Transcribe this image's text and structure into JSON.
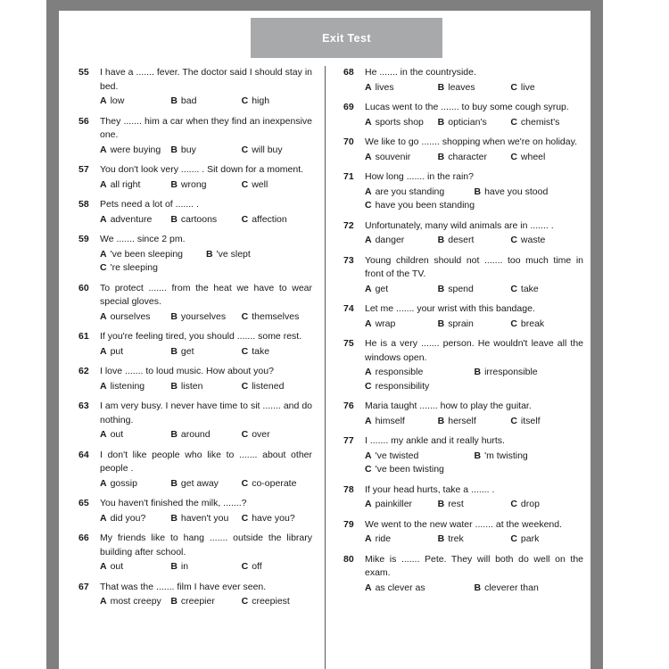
{
  "header": {
    "exit_label": "Exit Test"
  },
  "colors": {
    "frame_gray": "#7f7f7f",
    "exit_bar_gray": "#a7a9ab",
    "text": "#1a1a1a",
    "page_white": "#ffffff",
    "divider": "#58585a"
  },
  "left_column": [
    {
      "number": "55",
      "stem": "I have a ....... fever. The doctor said I should stay in bed.",
      "layout": "cols3",
      "options": [
        {
          "letter": "A",
          "text": "low"
        },
        {
          "letter": "B",
          "text": "bad"
        },
        {
          "letter": "C",
          "text": "high"
        }
      ]
    },
    {
      "number": "56",
      "stem": "They ....... him a car when they find an inexpensive one.",
      "layout": "cols3",
      "options": [
        {
          "letter": "A",
          "text": "were buying"
        },
        {
          "letter": "B",
          "text": "buy"
        },
        {
          "letter": "C",
          "text": "will buy"
        }
      ]
    },
    {
      "number": "57",
      "stem": "You don't look very ....... . Sit down for a moment.",
      "layout": "cols3",
      "options": [
        {
          "letter": "A",
          "text": "all right"
        },
        {
          "letter": "B",
          "text": "wrong"
        },
        {
          "letter": "C",
          "text": "well"
        }
      ]
    },
    {
      "number": "58",
      "stem": "Pets need a lot of ....... .",
      "layout": "cols3",
      "options": [
        {
          "letter": "A",
          "text": "adventure"
        },
        {
          "letter": "B",
          "text": "cartoons"
        },
        {
          "letter": "C",
          "text": "affection"
        }
      ]
    },
    {
      "number": "59",
      "stem": "We ....... since 2 pm.",
      "layout": "cols2",
      "options": [
        {
          "letter": "A",
          "text": "'ve been sleeping"
        },
        {
          "letter": "B",
          "text": "'ve slept"
        },
        {
          "letter": "C",
          "text": "'re sleeping",
          "full": true
        }
      ]
    },
    {
      "number": "60",
      "stem": "To protect ....... from the heat we have to wear special gloves.",
      "layout": "cols3",
      "options": [
        {
          "letter": "A",
          "text": "ourselves"
        },
        {
          "letter": "B",
          "text": "yourselves"
        },
        {
          "letter": "C",
          "text": "themselves"
        }
      ]
    },
    {
      "number": "61",
      "stem": "If you're feeling tired, you should ....... some rest.",
      "layout": "cols3",
      "options": [
        {
          "letter": "A",
          "text": "put"
        },
        {
          "letter": "B",
          "text": "get"
        },
        {
          "letter": "C",
          "text": "take"
        }
      ]
    },
    {
      "number": "62",
      "stem": "I love ....... to loud music. How about you?",
      "layout": "cols3",
      "options": [
        {
          "letter": "A",
          "text": "listening"
        },
        {
          "letter": "B",
          "text": "listen"
        },
        {
          "letter": "C",
          "text": "listened"
        }
      ]
    },
    {
      "number": "63",
      "stem": "I am very busy. I never have time to sit ....... and do nothing.",
      "layout": "cols3",
      "options": [
        {
          "letter": "A",
          "text": "out"
        },
        {
          "letter": "B",
          "text": "around"
        },
        {
          "letter": "C",
          "text": "over"
        }
      ]
    },
    {
      "number": "64",
      "stem": "I don't like people who like to ....... about other people .",
      "layout": "cols3",
      "options": [
        {
          "letter": "A",
          "text": "gossip"
        },
        {
          "letter": "B",
          "text": "get away"
        },
        {
          "letter": "C",
          "text": "co-operate"
        }
      ]
    },
    {
      "number": "65",
      "stem": "You haven't finished the milk, .......?",
      "layout": "cols3",
      "options": [
        {
          "letter": "A",
          "text": "did you?"
        },
        {
          "letter": "B",
          "text": "haven't you"
        },
        {
          "letter": "C",
          "text": "have you?"
        }
      ]
    },
    {
      "number": "66",
      "stem": "My friends like to hang ....... outside the library building after school.",
      "layout": "cols3",
      "options": [
        {
          "letter": "A",
          "text": "out"
        },
        {
          "letter": "B",
          "text": "in"
        },
        {
          "letter": "C",
          "text": "off"
        }
      ]
    },
    {
      "number": "67",
      "stem": "That was the ....... film I have ever seen.",
      "layout": "cols3",
      "options": [
        {
          "letter": "A",
          "text": "most creepy"
        },
        {
          "letter": "B",
          "text": "creepier"
        },
        {
          "letter": "C",
          "text": "creepiest"
        }
      ]
    }
  ],
  "right_column": [
    {
      "number": "68",
      "stem": "He ....... in the countryside.",
      "layout": "cols3",
      "options": [
        {
          "letter": "A",
          "text": "lives"
        },
        {
          "letter": "B",
          "text": "leaves"
        },
        {
          "letter": "C",
          "text": "live"
        }
      ]
    },
    {
      "number": "69",
      "stem": "Lucas went to the ....... to buy some cough syrup.",
      "layout": "cols3",
      "options": [
        {
          "letter": "A",
          "text": "sports shop"
        },
        {
          "letter": "B",
          "text": "optician's"
        },
        {
          "letter": "C",
          "text": "chemist's"
        }
      ]
    },
    {
      "number": "70",
      "stem": "We like to go ....... shopping when we're on holiday.",
      "layout": "cols3",
      "options": [
        {
          "letter": "A",
          "text": "souvenir"
        },
        {
          "letter": "B",
          "text": "character"
        },
        {
          "letter": "C",
          "text": "wheel"
        }
      ]
    },
    {
      "number": "71",
      "stem": "How long ....... in the rain?",
      "layout": "cols2",
      "options": [
        {
          "letter": "A",
          "text": "are you standing"
        },
        {
          "letter": "B",
          "text": "have you stood"
        },
        {
          "letter": "C",
          "text": "have you been standing",
          "full": true
        }
      ]
    },
    {
      "number": "72",
      "stem": "Unfortunately, many wild animals are in ....... .",
      "layout": "cols3",
      "options": [
        {
          "letter": "A",
          "text": "danger"
        },
        {
          "letter": "B",
          "text": "desert"
        },
        {
          "letter": "C",
          "text": "waste"
        }
      ]
    },
    {
      "number": "73",
      "stem": "Young children should not ....... too much time in front of the TV.",
      "layout": "cols3",
      "options": [
        {
          "letter": "A",
          "text": "get"
        },
        {
          "letter": "B",
          "text": "spend"
        },
        {
          "letter": "C",
          "text": "take"
        }
      ]
    },
    {
      "number": "74",
      "stem": "Let me ....... your wrist with this bandage.",
      "layout": "cols3",
      "options": [
        {
          "letter": "A",
          "text": "wrap"
        },
        {
          "letter": "B",
          "text": "sprain"
        },
        {
          "letter": "C",
          "text": "break"
        }
      ]
    },
    {
      "number": "75",
      "stem": "He is a very ....... person. He wouldn't leave all the windows open.",
      "layout": "cols2",
      "options": [
        {
          "letter": "A",
          "text": "responsible"
        },
        {
          "letter": "B",
          "text": "irresponsible"
        },
        {
          "letter": "C",
          "text": "responsibility",
          "full": true
        }
      ]
    },
    {
      "number": "76",
      "stem": "Maria taught ....... how to play the guitar.",
      "layout": "cols3",
      "options": [
        {
          "letter": "A",
          "text": "himself"
        },
        {
          "letter": "B",
          "text": "herself"
        },
        {
          "letter": "C",
          "text": "itself"
        }
      ]
    },
    {
      "number": "77",
      "stem": "I ....... my ankle and it really hurts.",
      "layout": "cols2",
      "options": [
        {
          "letter": "A",
          "text": "'ve twisted"
        },
        {
          "letter": "B",
          "text": "'m twisting"
        },
        {
          "letter": "C",
          "text": "'ve been twisting",
          "full": true
        }
      ]
    },
    {
      "number": "78",
      "stem": "If your head hurts, take a ....... .",
      "layout": "cols3",
      "options": [
        {
          "letter": "A",
          "text": "painkiller"
        },
        {
          "letter": "B",
          "text": "rest"
        },
        {
          "letter": "C",
          "text": "drop"
        }
      ]
    },
    {
      "number": "79",
      "stem": "We went to the new water ....... at the weekend.",
      "layout": "cols3",
      "options": [
        {
          "letter": "A",
          "text": "ride"
        },
        {
          "letter": "B",
          "text": "trek"
        },
        {
          "letter": "C",
          "text": "park"
        }
      ]
    },
    {
      "number": "80",
      "stem": "Mike is ....... Pete. They will both do well on the exam.",
      "layout": "cols2",
      "options": [
        {
          "letter": "A",
          "text": "as clever as"
        },
        {
          "letter": "B",
          "text": "cleverer than"
        }
      ]
    }
  ]
}
